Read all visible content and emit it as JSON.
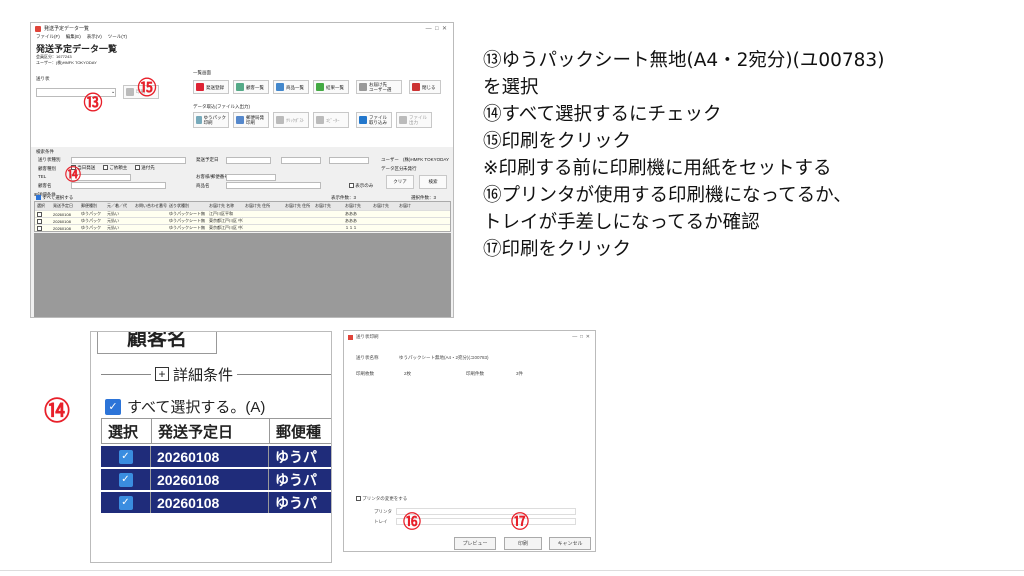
{
  "instructions": [
    "⑬ゆうパックシート無地(A4・2宛分)(ユ00783)",
    "を選択",
    "⑭すべて選択するにチェック",
    "⑮印刷をクリック",
    "※印刷する前に印刷機に用紙をセットする",
    "⑯プリンタが使用する印刷機になってるか、",
    "トレイが手差しになってるか確認",
    "⑰印刷をクリック"
  ],
  "markers": {
    "m13": "⑬",
    "m14a": "⑭",
    "m14b": "⑭",
    "m15": "⑮",
    "m16": "⑯",
    "m17": "⑰"
  },
  "app": {
    "window_title": "発送予定データ一覧",
    "menu": [
      "ファイル(F)",
      "編集(E)",
      "表示(V)",
      "ツール(T)"
    ],
    "heading": "発送予定データ一覧",
    "info1": "会員区分：1677243",
    "info2": "ユーザー：(株)HMFK TOKYODAY",
    "sheet_label": "送り状",
    "print_button": "印刷",
    "list_label": "一覧画面",
    "import_label": "データ取込(ファイル入出力)",
    "toolbar": [
      {
        "label": "発送登録",
        "color": "#d23"
      },
      {
        "label": "顧客一覧",
        "color": "#5a8"
      },
      {
        "label": "商品一覧",
        "color": "#48c"
      },
      {
        "label": "結果一覧",
        "color": "#4a4"
      },
      {
        "label": "お届け先\nユーザー選",
        "color": "#999"
      },
      {
        "label": "閉じる",
        "color": "#c33"
      }
    ],
    "toolbar2": [
      {
        "label": "ゆうパック\n印刷",
        "color": "#7ab"
      },
      {
        "label": "郵便局発\n印刷",
        "color": "#58c"
      },
      {
        "label": "ｸﾘｯｸﾎﾟｽﾄ",
        "color": "#bbb"
      },
      {
        "label": "ｺﾋﾟｰﾀｰ",
        "color": "#bbb"
      },
      {
        "label": "ファイル\n取り込み",
        "color": "#27c"
      },
      {
        "label": "ファイル\n出力",
        "color": "#bbb"
      }
    ],
    "search_title": "検索条件",
    "search_labels": [
      "送り状種別",
      "顧客種別",
      "TEL",
      "顧客名"
    ],
    "search_labels_right": [
      "発送予定日",
      "お客様/郵便番号",
      "商品名"
    ],
    "checks": [
      "当日発送",
      "ご依頼主",
      "送付先"
    ],
    "user_label": "ユーザー",
    "user_value": "(株)HMFK TOKYODAY",
    "data_label": "データ区分",
    "data_value": "未発行",
    "clear_button": "クリア",
    "search_button": "検索",
    "display_only_label": "表示のみ",
    "detail_toggle": "詳細条件",
    "select_all": "すべて選択する",
    "count_display": "表示件数：3",
    "selected_count": "選択件数：3",
    "grid_headers": [
      "選択",
      "発送予定日",
      "郵便種別",
      "元／着／代",
      "お問い合わせ番号",
      "送り状種別",
      "お届け先 名称",
      "お届け先 住所",
      "お届け先 住所",
      "お届け先",
      "お届け先",
      "お届け先",
      "お届け"
    ],
    "grid_rows": [
      [
        "",
        "20260108",
        "ゆうパック",
        "元払い",
        "",
        "ゆうパックシート無（地）",
        "江戸川区平和",
        "",
        "",
        "",
        "あああ",
        ""
      ],
      [
        "",
        "20260108",
        "ゆうパック",
        "元払い",
        "",
        "ゆうパックシート無（地）",
        "東京都江戸川区 中葛西",
        "",
        "",
        "",
        "あああ",
        ""
      ],
      [
        "",
        "20260108",
        "ゆうパック",
        "元払い",
        "",
        "ゆうパックシート無（地）",
        "東京都江戸川区 中葛西",
        "",
        "",
        "",
        "１１１",
        ""
      ]
    ]
  },
  "zoom": {
    "tab_label": "顧客名",
    "group_label": "詳細条件",
    "select_all": "すべて選択する。(A)",
    "headers": [
      "選択",
      "発送予定日",
      "郵便種"
    ],
    "rows": [
      {
        "date": "20260108",
        "type": "ゆうパ"
      },
      {
        "date": "20260108",
        "type": "ゆうパ"
      },
      {
        "date": "20260108",
        "type": "ゆうパ"
      }
    ]
  },
  "dialog": {
    "title": "送り状印刷",
    "sheet_label": "送り状名称",
    "sheet_value": "ゆうパックシート無地(A4・2宛分)(ユ00783)",
    "pages_label": "印刷枚数",
    "pages_value": "2枚",
    "count_label": "印刷件数",
    "count_value": "3件",
    "change_printer": "プリンタの変更をする",
    "printer_label": "プリンタ",
    "printer_value": "",
    "tray_label": "トレイ",
    "tray_value": "",
    "preview_button": "プレビュー",
    "print_button": "印刷",
    "cancel_button": "キャンセル"
  }
}
